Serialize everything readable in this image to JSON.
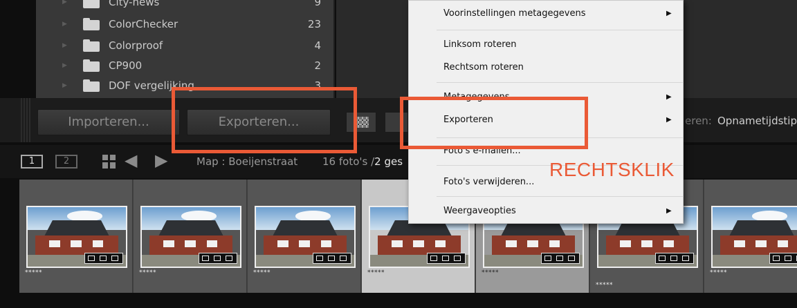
{
  "folders": [
    {
      "name": "City-news",
      "count": "9"
    },
    {
      "name": "ColorChecker",
      "count": "23"
    },
    {
      "name": "Colorproof",
      "count": "4"
    },
    {
      "name": "CP900",
      "count": "2"
    },
    {
      "name": "DOF vergelijking",
      "count": "3"
    }
  ],
  "toolbar": {
    "import_label": "Importeren...",
    "export_label": "Exporteren...",
    "sort_label": "eren:",
    "sort_value": "Opnametijdstip"
  },
  "filmstrip_toolbar": {
    "screen1": "1",
    "screen2": "2",
    "folder_path": "Map : Boeijenstraat",
    "photo_count_prefix": "16 foto's /",
    "photo_count_selected": "2 ges"
  },
  "filmstrip": {
    "ratings": [
      "*****",
      "*****",
      "*****",
      "*****",
      "*****",
      "*****",
      "*****"
    ]
  },
  "context_menu": {
    "items": [
      {
        "label": "Voorinstellingen metagegevens",
        "submenu": true
      },
      {
        "label": "Linksom roteren",
        "submenu": false
      },
      {
        "label": "Rechtsom roteren",
        "submenu": false
      },
      {
        "label": "Metagegevens",
        "submenu": true
      },
      {
        "label": "Exporteren",
        "submenu": true
      },
      {
        "label": "Foto's e-mailen...",
        "submenu": false
      },
      {
        "label": "Foto's verwijderen...",
        "submenu": false
      },
      {
        "label": "Weergaveopties",
        "submenu": true
      }
    ],
    "submenu_arrow": "▶"
  },
  "annotation": {
    "text": "RECHTSKLIK",
    "color": "#ea5a36"
  },
  "icons": {
    "arrow_back": "◆",
    "arrow_forward": "◆",
    "folder_expand": "▶"
  }
}
